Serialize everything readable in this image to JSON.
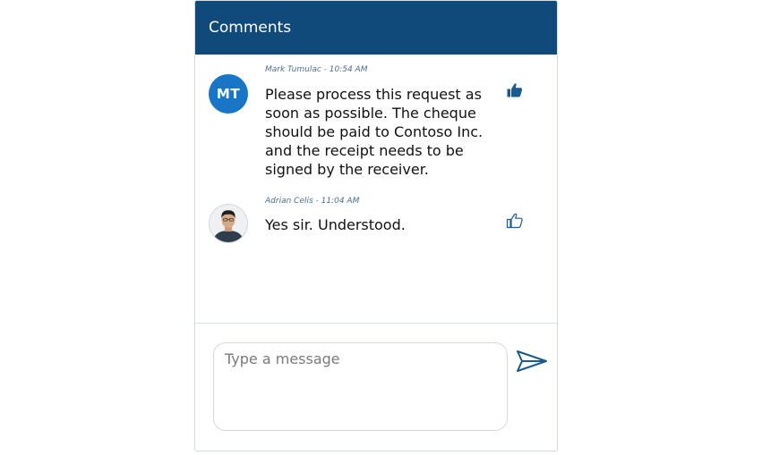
{
  "header": {
    "title": "Comments"
  },
  "comments": [
    {
      "author": "Mark Tumulac",
      "time": "10:54 AM",
      "meta": "Mark Tumulac - 10:54 AM",
      "initials": "MT",
      "avatar_type": "initials",
      "text": "Please process this request as soon as possible. The cheque should be paid to Contoso Inc. and the receipt needs to be signed by the receiver.",
      "liked": true,
      "like_icon": "thumbs-up-filled-icon"
    },
    {
      "author": "Adrian Celis",
      "time": "11:04 AM",
      "meta": "Adrian Celis - 11:04 AM",
      "avatar_type": "photo",
      "text": "Yes sir. Understood.",
      "liked": false,
      "like_icon": "thumbs-up-outline-icon"
    }
  ],
  "composer": {
    "placeholder": "Type a message",
    "value": "",
    "send_icon": "send-icon"
  },
  "colors": {
    "header_bg": "#0f4a7b",
    "avatar_bg": "#1976c7",
    "icon": "#1b5a8a"
  }
}
